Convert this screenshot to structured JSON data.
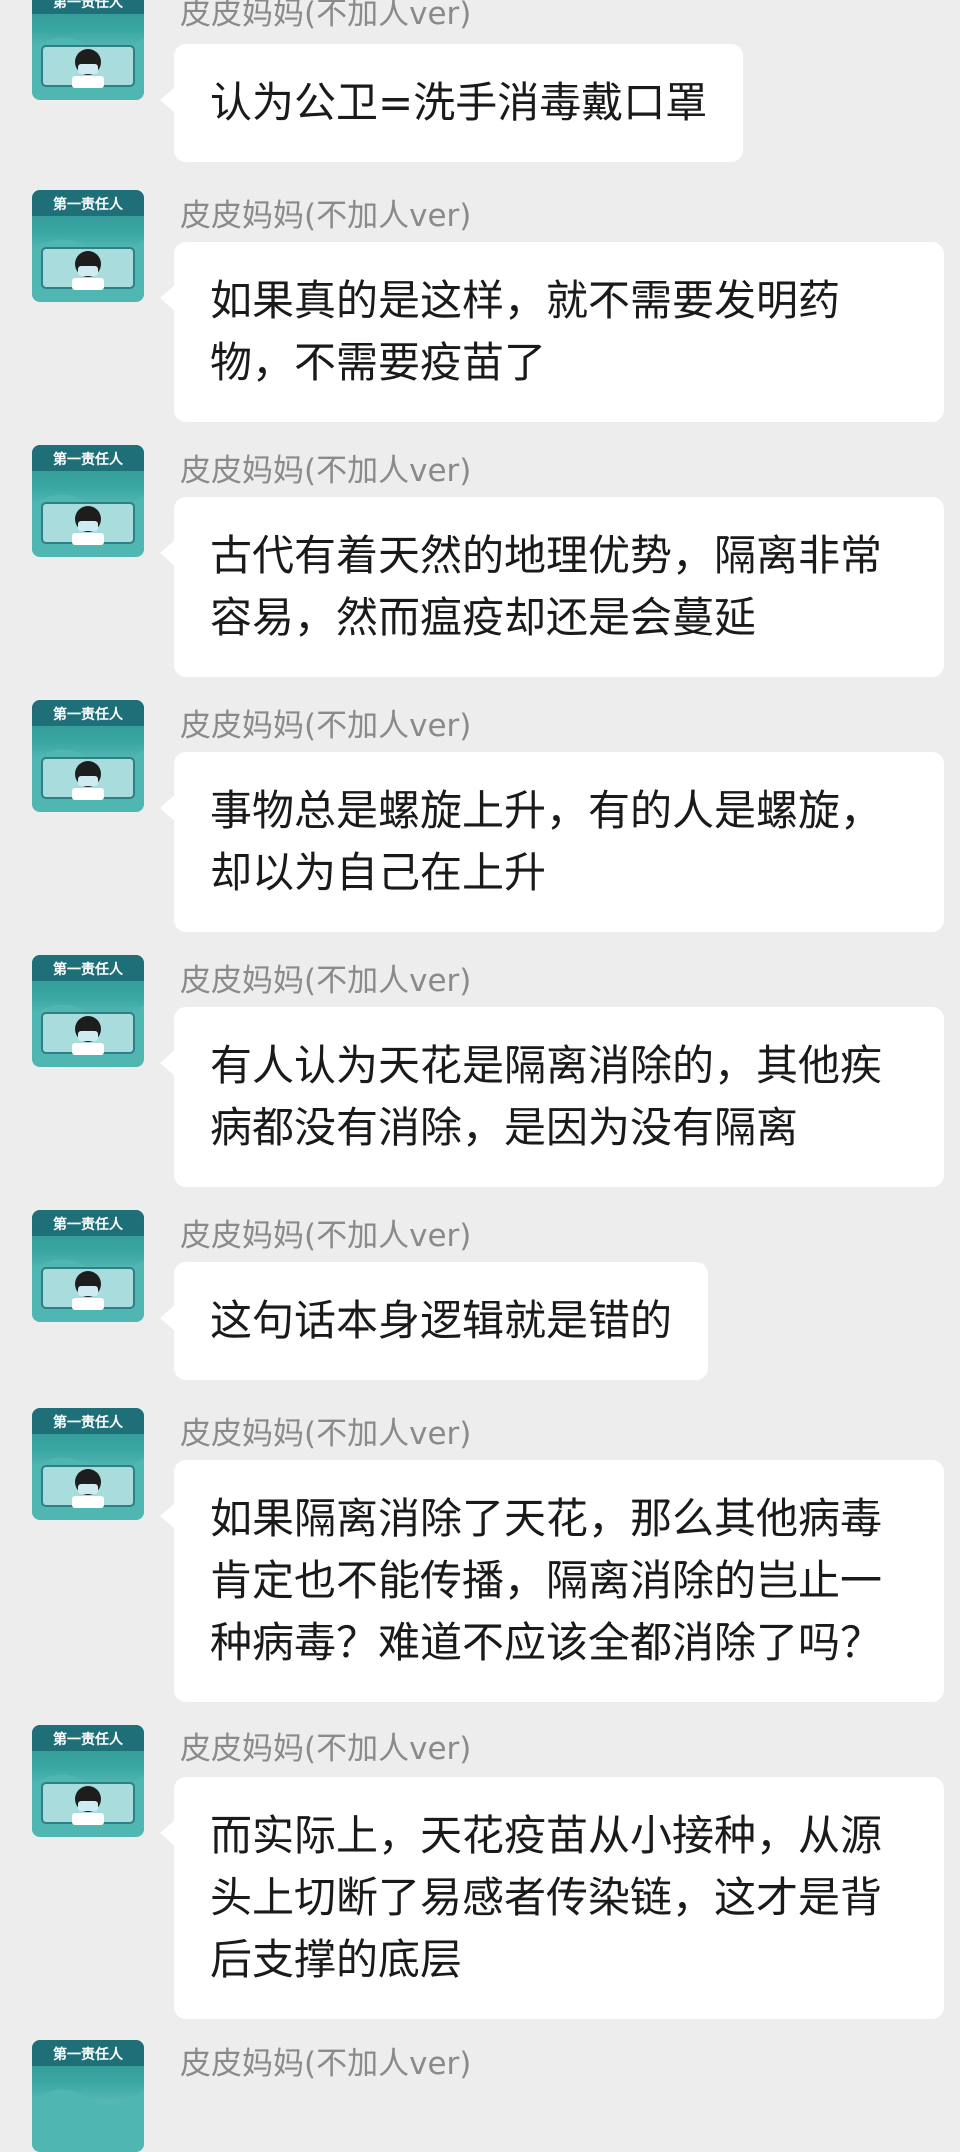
{
  "chat": {
    "colors": {
      "background": "#ededed",
      "bubble": "#ffffff",
      "sender": "#8a8a8a",
      "text": "#1a1a1a"
    },
    "avatar_icon": "avatar-icon",
    "avatar_banner_text": "第一责任人",
    "messages": [
      {
        "sender": "皮皮妈妈(不加人ver)",
        "text": "认为公卫=洗手消毒戴口罩"
      },
      {
        "sender": "皮皮妈妈(不加人ver)",
        "text": "如果真的是这样，就不需要发明药物，不需要疫苗了"
      },
      {
        "sender": "皮皮妈妈(不加人ver)",
        "text": "古代有着天然的地理优势，隔离非常容易，然而瘟疫却还是会蔓延"
      },
      {
        "sender": "皮皮妈妈(不加人ver)",
        "text": "事物总是螺旋上升，有的人是螺旋，却以为自己在上升"
      },
      {
        "sender": "皮皮妈妈(不加人ver)",
        "text": "有人认为天花是隔离消除的，其他疾病都没有消除，是因为没有隔离"
      },
      {
        "sender": "皮皮妈妈(不加人ver)",
        "text": "这句话本身逻辑就是错的"
      },
      {
        "sender": "皮皮妈妈(不加人ver)",
        "text": "如果隔离消除了天花，那么其他病毒肯定也不能传播，隔离消除的岂止一种病毒？难道不应该全都消除了吗？"
      },
      {
        "sender": "皮皮妈妈(不加人ver)",
        "text": "而实际上，天花疫苗从小接种，从源头上切断了易感者传染链，这才是背后支撑的底层"
      },
      {
        "sender": "皮皮妈妈(不加人ver)",
        "text": ""
      }
    ]
  }
}
